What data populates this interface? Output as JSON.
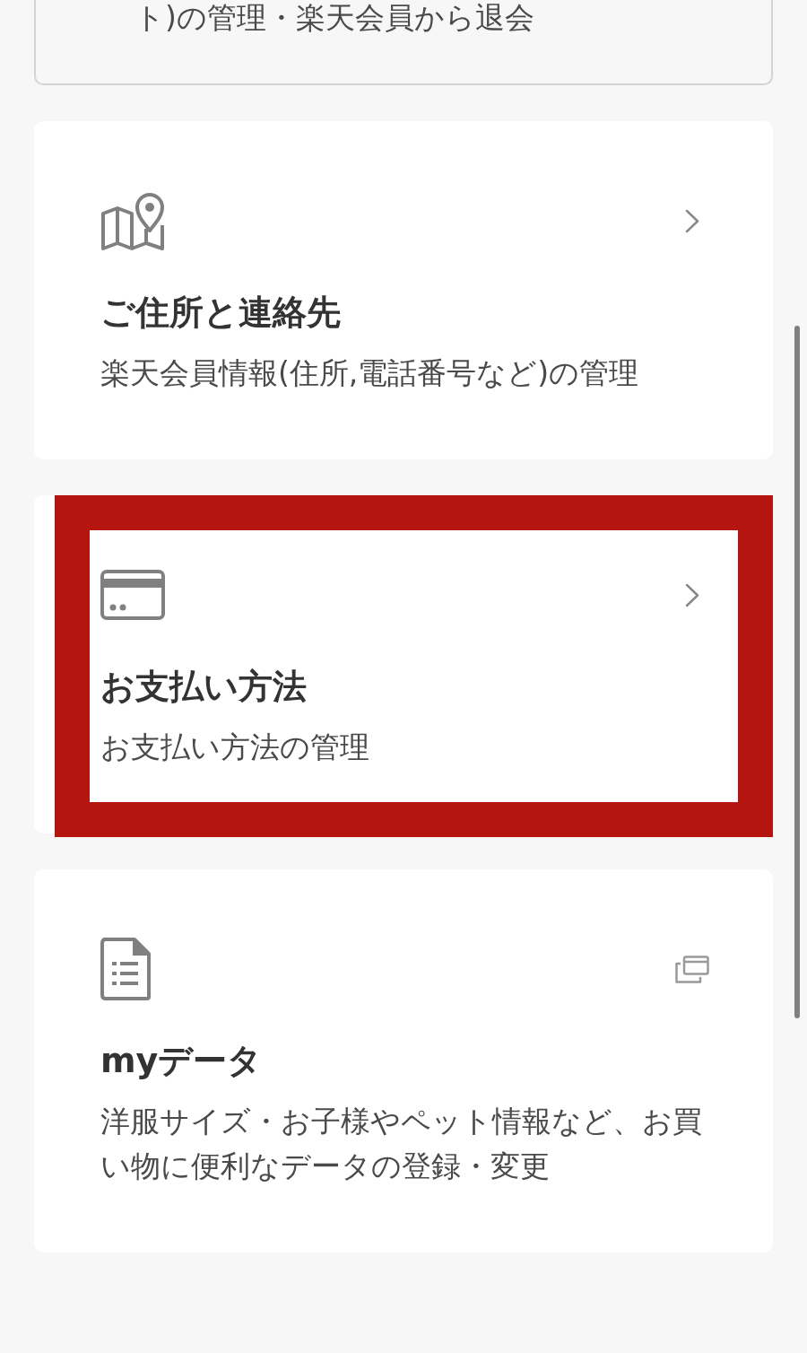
{
  "partial_card": {
    "description": "ト)の管理・楽天会員から退会"
  },
  "cards": [
    {
      "kind": "address",
      "title": "ご住所と連絡先",
      "description": "楽天会員情報(住所,電話番号など)の管理",
      "external": false,
      "highlighted": false
    },
    {
      "kind": "payment",
      "title": "お支払い方法",
      "description": "お支払い方法の管理",
      "external": false,
      "highlighted": true
    },
    {
      "kind": "data",
      "title": "myデータ",
      "description": "洋服サイズ・お子様やペット情報など、お買い物に便利なデータの登録・変更",
      "external": true,
      "highlighted": false
    }
  ]
}
